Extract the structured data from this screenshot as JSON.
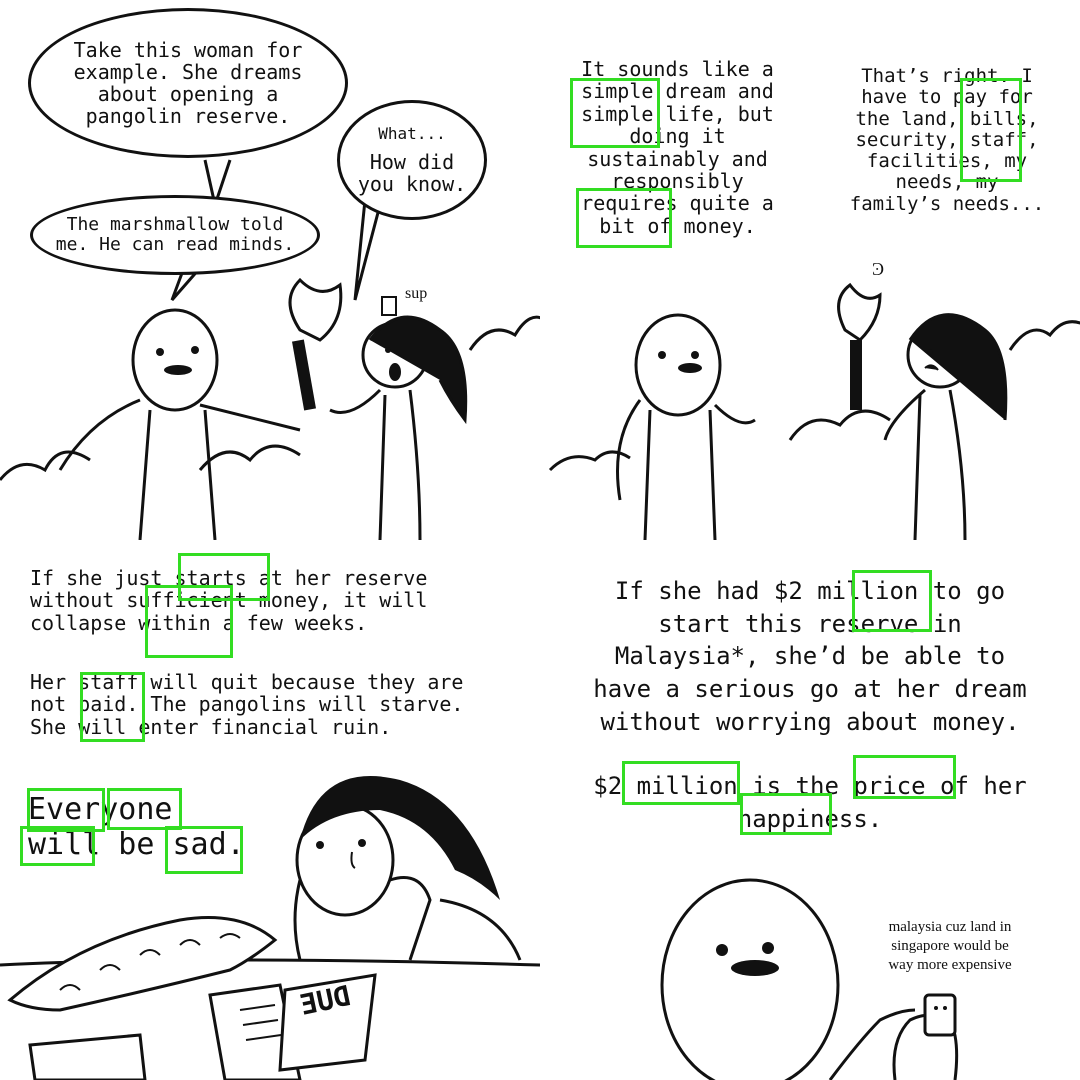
{
  "panel1": {
    "bubble_woman_example": "Take this woman for\nexample. She dreams\nabout opening a\npangolin reserve.",
    "bubble_what": "What...",
    "bubble_how": "How did\nyou know.",
    "bubble_marshmallow": "The marshmallow told\nme. He can read minds.",
    "phone_note": "sup"
  },
  "panel2": {
    "caption_left": "It sounds like a\nsimple dream and\nsimple life, but\ndoing it\nsustainably and\nresponsibly\nrequires quite a\nbit of money.",
    "caption_right": "That’s right. I\nhave to pay for\nthe land, bills,\nsecurity, staff,\nfacilities, my\nneeds, my\nfamily’s needs...",
    "thought_mark": "Ͽ"
  },
  "panel3": {
    "caption_top": "If she just starts at her reserve\nwithout sufficient money, it will\ncollapse within a few weeks.",
    "caption_mid": "Her staff will quit because they are\nnot paid. The pangolins will starve.\nShe will enter financial ruin.",
    "caption_big": "Everyone\nwill be sad.",
    "due_stamp": "DUE"
  },
  "panel4": {
    "caption_top": "If she had $2 million to go\nstart this reserve in\nMalaysia*, she’d be able to\nhave a serious go at her dream\nwithout worrying about money.",
    "caption_bottom": "$2 million is the price of her\nhappiness.",
    "footnote": "malaysia cuz land in\nsingapore would be\nway more expensive"
  },
  "colors": {
    "ink": "#111111",
    "highlight": "#33dd22",
    "background": "#ffffff"
  }
}
